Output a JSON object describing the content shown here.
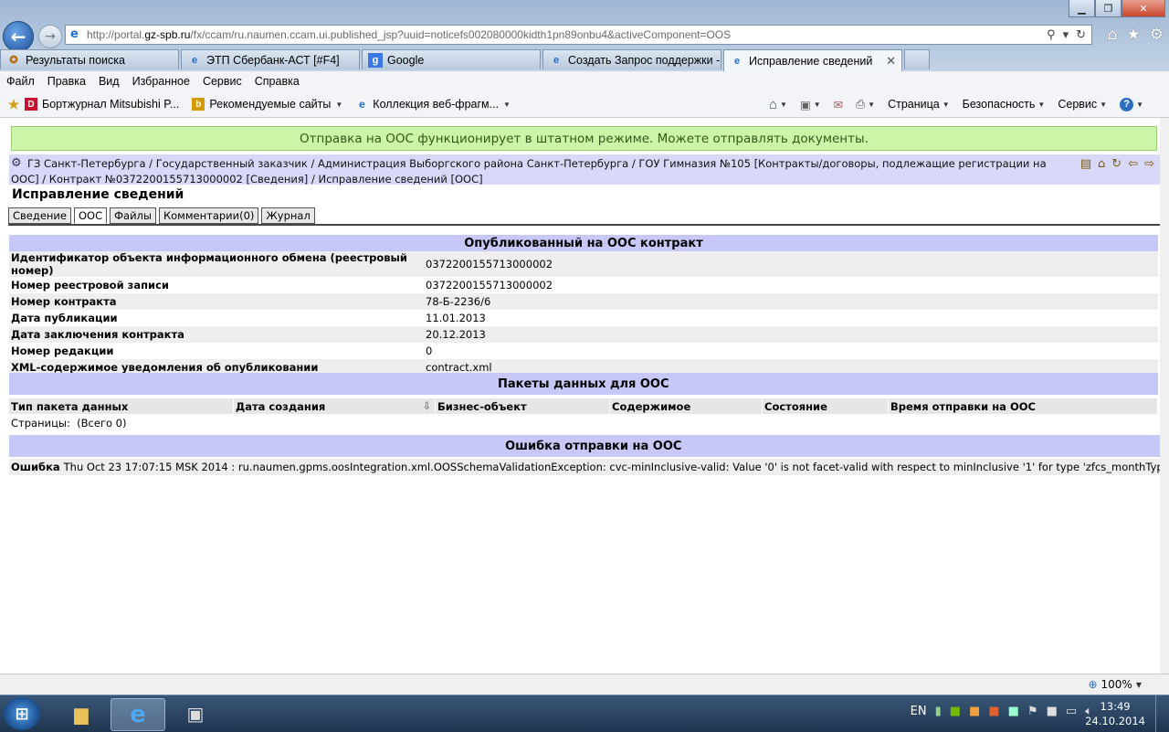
{
  "browser": {
    "url_prefix": "http://portal.",
    "url_domain": "gz-spb.ru",
    "url_rest": "/fx/ccam/ru.naumen.ccam.ui.published_jsp?uuid=noticefs002080000kidth1pn89onbu4&activeComponent=OOS",
    "tabs": [
      {
        "label": "Результаты поиска",
        "icon": "search-favicon"
      },
      {
        "label": "ЭТП Сбербанк-АСТ [#F4]",
        "icon": "ie-favicon"
      },
      {
        "label": "Google",
        "icon": "google-favicon"
      },
      {
        "label": "Создать Запрос поддержки - ...",
        "icon": "ie-favicon"
      },
      {
        "label": "Исправление сведений",
        "icon": "ie-favicon",
        "active": true
      }
    ],
    "menu": [
      "Файл",
      "Правка",
      "Вид",
      "Избранное",
      "Сервис",
      "Справка"
    ],
    "favorites": [
      {
        "label": "Бортжурнал Mitsubishi P...",
        "icon": "d-icon"
      },
      {
        "label": "Рекомендуемые сайты",
        "icon": "bing-icon"
      },
      {
        "label": "Коллекция веб-фрагм...",
        "icon": "ie-icon"
      }
    ],
    "commands": [
      "Страница",
      "Безопасность",
      "Сервис"
    ],
    "zoom": "100%"
  },
  "page": {
    "banner": "Отправка на ООС функционирует в штатном режиме. Можете отправлять документы.",
    "breadcrumb": "ГЗ Санкт-Петербурга / Государственный заказчик / Администрация Выборгского района Санкт-Петербурга / ГОУ Гимназия №105 [Контракты/договоры, подлежащие регистрации на ООС] / Контракт №0372200155713000002 [Сведения] / Исправление сведений [ООС]",
    "title": "Исправление сведений",
    "tabs": [
      "Сведение",
      "ООС",
      "Файлы",
      "Комментарии(0)",
      "Журнал"
    ],
    "published": {
      "heading": "Опубликованный на ООС контракт",
      "rows": [
        {
          "label": "Идентификатор объекта информационного обмена (реестровый номер)",
          "value": "0372200155713000002"
        },
        {
          "label": "Номер реестровой записи",
          "value": "0372200155713000002"
        },
        {
          "label": "Номер контракта",
          "value": "78-Б-2236/6"
        },
        {
          "label": "Дата публикации",
          "value": "11.01.2013"
        },
        {
          "label": "Дата заключения контракта",
          "value": "20.12.2013"
        },
        {
          "label": "Номер редакции",
          "value": "0"
        },
        {
          "label": "XML-содержимое уведомления об опубликовании",
          "value": "contract.xml"
        }
      ]
    },
    "packets": {
      "heading": "Пакеты данных для ООС",
      "columns": [
        "Тип пакета данных",
        "Дата создания",
        "Бизнес-объект",
        "Содержимое",
        "Состояние",
        "Время отправки на ООС"
      ],
      "pages_label": "Страницы:",
      "pages_total": "(Всего 0)"
    },
    "error": {
      "heading": "Ошибка отправки на ООС",
      "label": "Ошибка",
      "message": "Thu Oct 23 17:07:15 MSK 2014 : ru.naumen.gpms.oosIntegration.xml.OOSSchemaValidationException: cvc-minInclusive-valid: Value '0' is not facet-valid with respect to minInclusive '1' for type 'zfcs_monthType'."
    }
  },
  "taskbar": {
    "language": "EN",
    "time": "13:49",
    "date": "24.10.2014"
  }
}
